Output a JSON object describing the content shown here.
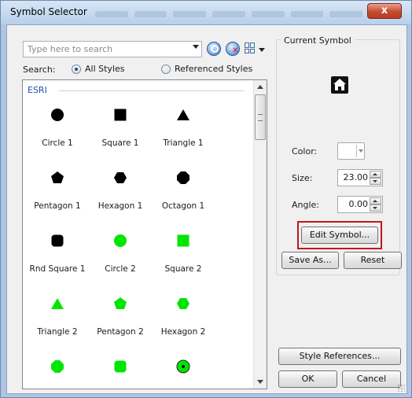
{
  "window": {
    "title": "Symbol Selector",
    "close_label": "x"
  },
  "search": {
    "placeholder": "Type here to search",
    "label": "Search:",
    "options": [
      "All Styles",
      "Referenced Styles"
    ],
    "selected": "All Styles"
  },
  "list": {
    "group": "ESRI",
    "items": [
      {
        "label": "Circle 1",
        "shape": "circle",
        "color": "#000000"
      },
      {
        "label": "Square 1",
        "shape": "square",
        "color": "#000000"
      },
      {
        "label": "Triangle 1",
        "shape": "triangle",
        "color": "#000000"
      },
      {
        "label": "Pentagon 1",
        "shape": "pentagon",
        "color": "#000000"
      },
      {
        "label": "Hexagon 1",
        "shape": "hexagon",
        "color": "#000000"
      },
      {
        "label": "Octagon 1",
        "shape": "octagon",
        "color": "#000000"
      },
      {
        "label": "Rnd Square 1",
        "shape": "rounded-square",
        "color": "#000000"
      },
      {
        "label": "Circle 2",
        "shape": "circle",
        "color": "#00e600"
      },
      {
        "label": "Square 2",
        "shape": "square",
        "color": "#00e600"
      },
      {
        "label": "Triangle 2",
        "shape": "triangle",
        "color": "#00e600"
      },
      {
        "label": "Pentagon 2",
        "shape": "pentagon",
        "color": "#00e600"
      },
      {
        "label": "Hexagon 2",
        "shape": "hexagon",
        "color": "#00e600"
      },
      {
        "label": "",
        "shape": "octagon",
        "color": "#00e600"
      },
      {
        "label": "",
        "shape": "rounded-square",
        "color": "#00e600"
      },
      {
        "label": "",
        "shape": "circle-dot",
        "color": "#00e600"
      }
    ]
  },
  "current_symbol": {
    "title": "Current Symbol",
    "preview_icon": "home-icon",
    "color_label": "Color:",
    "size_label": "Size:",
    "size_value": "23.00",
    "angle_label": "Angle:",
    "angle_value": "0.00",
    "edit_label": "Edit Symbol...",
    "save_as_label": "Save As...",
    "reset_label": "Reset"
  },
  "footer": {
    "style_references_label": "Style References...",
    "ok_label": "OK",
    "cancel_label": "Cancel"
  },
  "colors": {
    "accent": "#1a52a8",
    "highlight": "#c0171e",
    "symbol_green": "#00e600"
  }
}
